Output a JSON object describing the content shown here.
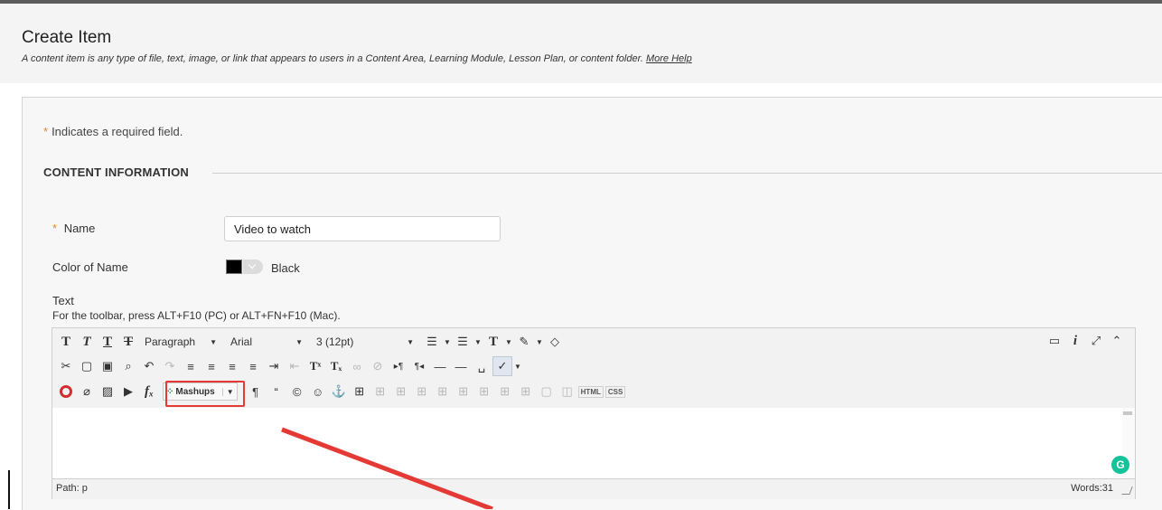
{
  "header": {
    "title": "Create Item",
    "description": "A content item is any type of file, text, image, or link that appears to users in a Content Area, Learning Module, Lesson Plan, or content folder.",
    "help_link": "More Help"
  },
  "form": {
    "required_marker": "*",
    "required_note": "Indicates a required field.",
    "section_title": "CONTENT INFORMATION",
    "name_label": "Name",
    "name_value": "Video to watch",
    "color_label": "Color of Name",
    "color_value": "Black",
    "color_swatch": "#000000",
    "text_label": "Text",
    "toolbar_hint": "For the toolbar, press ALT+F10 (PC) or ALT+FN+F10 (Mac)."
  },
  "editor": {
    "paragraph_select": "Paragraph",
    "font_select": "Arial",
    "size_select": "3 (12pt)",
    "mashups_label": "Mashups",
    "html_label": "HTML",
    "css_label": "CSS",
    "path_text": "Path: p",
    "words_text": "Words:31",
    "grammarly_letter": "G"
  },
  "colors": {
    "accent_required": "#e7872b",
    "highlight": "#e53935",
    "grammarly": "#15c39a"
  }
}
